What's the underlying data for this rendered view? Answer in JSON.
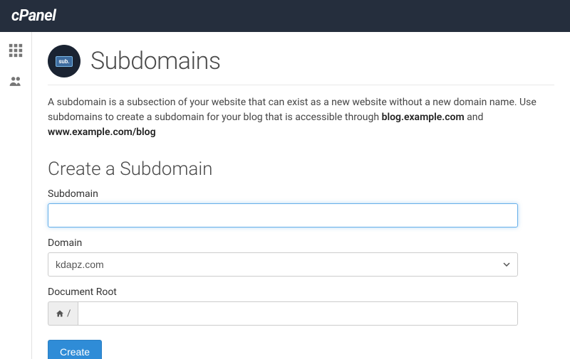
{
  "brand": "cPanel",
  "page": {
    "icon_text": "sub.",
    "title": "Subdomains",
    "description_prefix": "A subdomain is a subsection of your website that can exist as a new website without a new domain name. Use subdomains to create a subdomain for your blog that is accessible through ",
    "description_bold1": "blog.example.com",
    "description_mid": " and ",
    "description_bold2": "www.example.com/blog"
  },
  "form": {
    "section_title": "Create a Subdomain",
    "subdomain_label": "Subdomain",
    "subdomain_value": "",
    "domain_label": "Domain",
    "domain_selected": "kdapz.com",
    "document_root_label": "Document Root",
    "document_root_prefix": "/",
    "document_root_value": "",
    "create_button": "Create"
  }
}
